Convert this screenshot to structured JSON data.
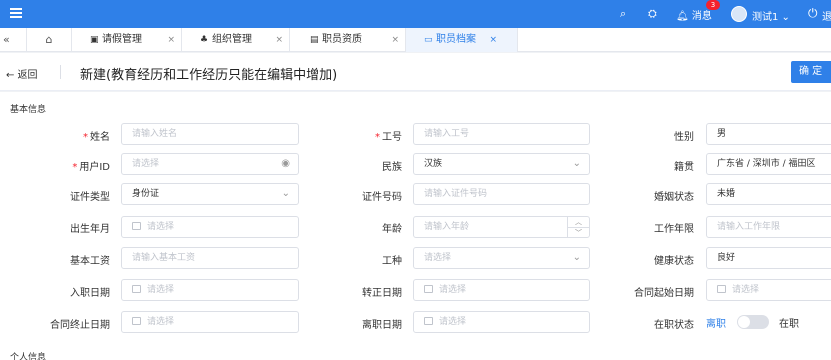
{
  "topbar": {
    "search_icon": "search-icon",
    "message_label": "消息",
    "message_count": "3",
    "user_name": "测试1",
    "exit_label": "退"
  },
  "tabs": {
    "collapse_icon": "«",
    "home_icon": "⌂",
    "items": [
      {
        "label": "请假管理",
        "icon": "▣",
        "close": "×"
      },
      {
        "label": "组织管理",
        "icon": "♣",
        "close": "×"
      },
      {
        "label": "职员资质",
        "icon": "▤",
        "close": "×"
      },
      {
        "label": "职员档案",
        "icon": "▭",
        "close": "×"
      }
    ]
  },
  "header": {
    "back_label": "← 返回",
    "title": "新建(教育经历和工作经历只能在编辑中增加)",
    "confirm_label": "确 定"
  },
  "sections": {
    "basic": "基本信息",
    "personal": "个人信息"
  },
  "form": {
    "name": {
      "label": "姓名",
      "placeholder": "请输入姓名"
    },
    "job_no": {
      "label": "工号",
      "placeholder": "请输入工号"
    },
    "gender": {
      "label": "性别",
      "value": "男"
    },
    "user_id": {
      "label": "用户ID",
      "placeholder": "请选择"
    },
    "ethnicity": {
      "label": "民族",
      "value": "汉族"
    },
    "native_place": {
      "label": "籍贯",
      "value": "广东省 / 深圳市 / 福田区"
    },
    "id_type": {
      "label": "证件类型",
      "value": "身份证"
    },
    "id_no": {
      "label": "证件号码",
      "placeholder": "请输入证件号码"
    },
    "marital": {
      "label": "婚姻状态",
      "value": "未婚"
    },
    "birth_month": {
      "label": "出生年月",
      "placeholder": "请选择"
    },
    "age": {
      "label": "年龄",
      "placeholder": "请输入年龄"
    },
    "work_years": {
      "label": "工作年限",
      "placeholder": "请输入工作年限"
    },
    "base_salary": {
      "label": "基本工资",
      "placeholder": "请输入基本工资"
    },
    "job_type": {
      "label": "工种",
      "placeholder": "请选择"
    },
    "health": {
      "label": "健康状态",
      "value": "良好"
    },
    "entry_date": {
      "label": "入职日期",
      "placeholder": "请选择"
    },
    "regular_date": {
      "label": "转正日期",
      "placeholder": "请选择"
    },
    "contract_start": {
      "label": "合同起始日期",
      "placeholder": "请选择"
    },
    "contract_end": {
      "label": "合同终止日期",
      "placeholder": "请选择"
    },
    "leave_date": {
      "label": "离职日期",
      "placeholder": "请选择"
    },
    "status": {
      "label": "在职状态",
      "off_label": "离职",
      "on_label": "在职"
    }
  },
  "colors": {
    "primary": "#2f80e8",
    "required": "#f5222d"
  }
}
